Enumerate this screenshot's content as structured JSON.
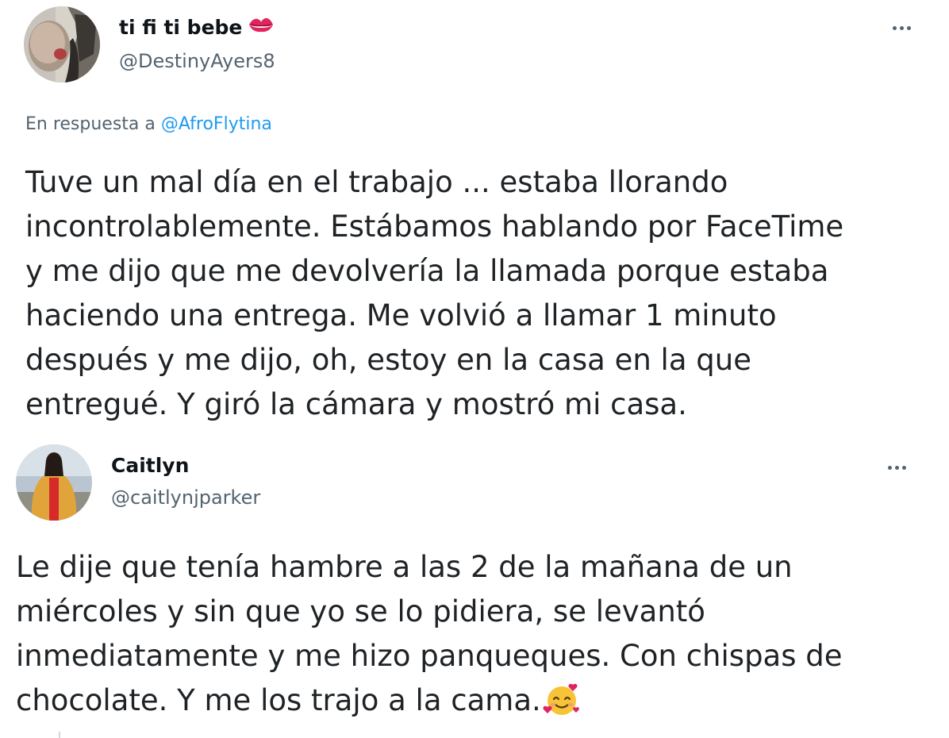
{
  "tweets": [
    {
      "display_name": "ti fi ti bebe",
      "name_emoji": "kiss-mark-icon",
      "handle": "@DestinyAyers8",
      "reply_prefix": "En respuesta a",
      "reply_mention": "@AfroFlytina",
      "text_lines": [
        "Tuve un mal día en el trabajo ... estaba llorando",
        "incontrolablemente. Estábamos hablando por FaceTime",
        "y me dijo que me devolvería la llamada porque estaba",
        "haciendo una entrega. Me volvió a llamar 1 minuto",
        "después y me dijo, oh, estoy en la casa en la que",
        "entregué. Y giró la cámara y mostró mi casa."
      ]
    },
    {
      "display_name": "Caitlyn",
      "handle": "@caitlynjparker",
      "text_lines": [
        "Le dije que tenía hambre a las 2 de la mañana de un",
        "miércoles y sin que yo se lo pidiera, se levantó",
        "inmediatamente y me hizo panqueques. Con chispas de",
        "chocolate. Y me los trajo a la cama."
      ],
      "text_emoji": "smiling-face-with-hearts-icon"
    }
  ],
  "colors": {
    "text_primary": "#0f1419",
    "text_secondary": "#536471",
    "link": "#1d9bf0",
    "kiss_red": "#e0245e"
  }
}
